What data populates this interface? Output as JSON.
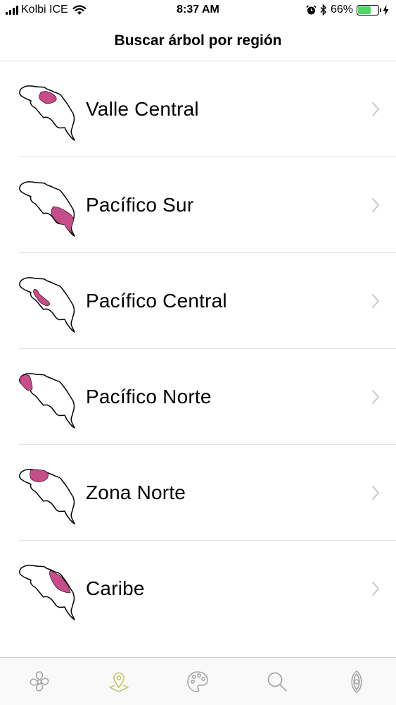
{
  "status_bar": {
    "carrier": "Kolbi ICE",
    "time": "8:37 AM",
    "battery_percent": "66%",
    "battery_level": 0.66
  },
  "header": {
    "title": "Buscar árbol por región"
  },
  "regions": [
    {
      "label": "Valle Central",
      "highlight": "valle-central"
    },
    {
      "label": "Pacífico Sur",
      "highlight": "pacifico-sur"
    },
    {
      "label": "Pacífico Central",
      "highlight": "pacifico-central"
    },
    {
      "label": "Pacífico Norte",
      "highlight": "pacifico-norte"
    },
    {
      "label": "Zona Norte",
      "highlight": "zona-norte"
    },
    {
      "label": "Caribe",
      "highlight": "caribe"
    }
  ],
  "tabs": [
    {
      "icon": "flower-icon",
      "selected": false
    },
    {
      "icon": "map-pin-icon",
      "selected": true
    },
    {
      "icon": "palette-icon",
      "selected": false
    },
    {
      "icon": "search-icon",
      "selected": false
    },
    {
      "icon": "seed-icon",
      "selected": false
    }
  ],
  "colors": {
    "highlight": "#c84b8a",
    "tab_selected": "#c3c96a",
    "tab_default": "#a6a6a6",
    "chevron": "#c7c7cc"
  }
}
